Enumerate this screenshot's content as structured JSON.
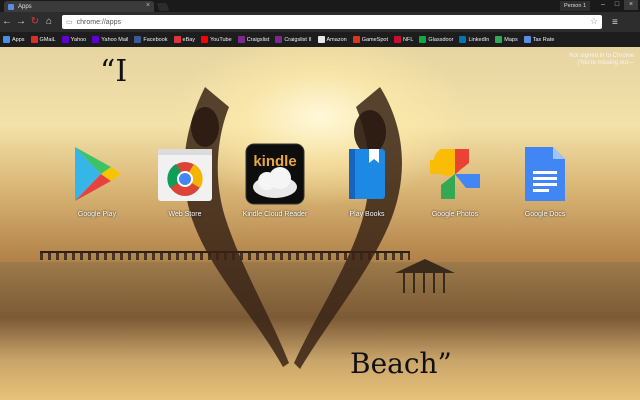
{
  "tab": {
    "title": "Apps",
    "close": "×"
  },
  "profile": {
    "label": "Person 1"
  },
  "window_controls": {
    "minimize": "–",
    "maximize": "□",
    "close": "×"
  },
  "toolbar": {
    "back": "←",
    "forward": "→",
    "reload": "↻",
    "home": "⌂",
    "menu": "≡"
  },
  "omnibox": {
    "value": "chrome://apps",
    "page_icon": "▭",
    "star": "☆"
  },
  "bookmarks": [
    {
      "label": "Apps",
      "color": "#4a90e2"
    },
    {
      "label": "GMaiL",
      "color": "#d93025"
    },
    {
      "label": "Yahoo",
      "color": "#6001d2"
    },
    {
      "label": "Yahoo Mail",
      "color": "#6001d2"
    },
    {
      "label": "Facebook",
      "color": "#3b5998"
    },
    {
      "label": "eBay",
      "color": "#e53238"
    },
    {
      "label": "YouTube",
      "color": "#ff0000"
    },
    {
      "label": "Craigslist",
      "color": "#7b2b8c"
    },
    {
      "label": "Craigslist II",
      "color": "#7b2b8c"
    },
    {
      "label": "Amazon",
      "color": "#e8e8e8"
    },
    {
      "label": "GameSpot",
      "color": "#d9361e"
    },
    {
      "label": "NFL",
      "color": "#c8102e"
    },
    {
      "label": "Glassdoor",
      "color": "#0caa41"
    },
    {
      "label": "LinkedIn",
      "color": "#0077b5"
    },
    {
      "label": "Maps",
      "color": "#34a853"
    },
    {
      "label": "Tax Rate",
      "color": "#5a8de0"
    }
  ],
  "signin": {
    "line1": "Not signed in to Chrome",
    "line2": "(You're missing out—"
  },
  "quote": {
    "top": "“I",
    "bottom": "Beach”"
  },
  "apps": [
    {
      "label": "Google Play",
      "icon": "google-play-icon"
    },
    {
      "label": "Web Store",
      "icon": "chrome-web-store-icon"
    },
    {
      "label": "Kindle Cloud Reader",
      "icon": "kindle-icon",
      "icon_text": "kindle"
    },
    {
      "label": "Play Books",
      "icon": "play-books-icon"
    },
    {
      "label": "Google Photos",
      "icon": "google-photos-icon"
    },
    {
      "label": "Google Docs",
      "icon": "google-docs-icon"
    }
  ]
}
